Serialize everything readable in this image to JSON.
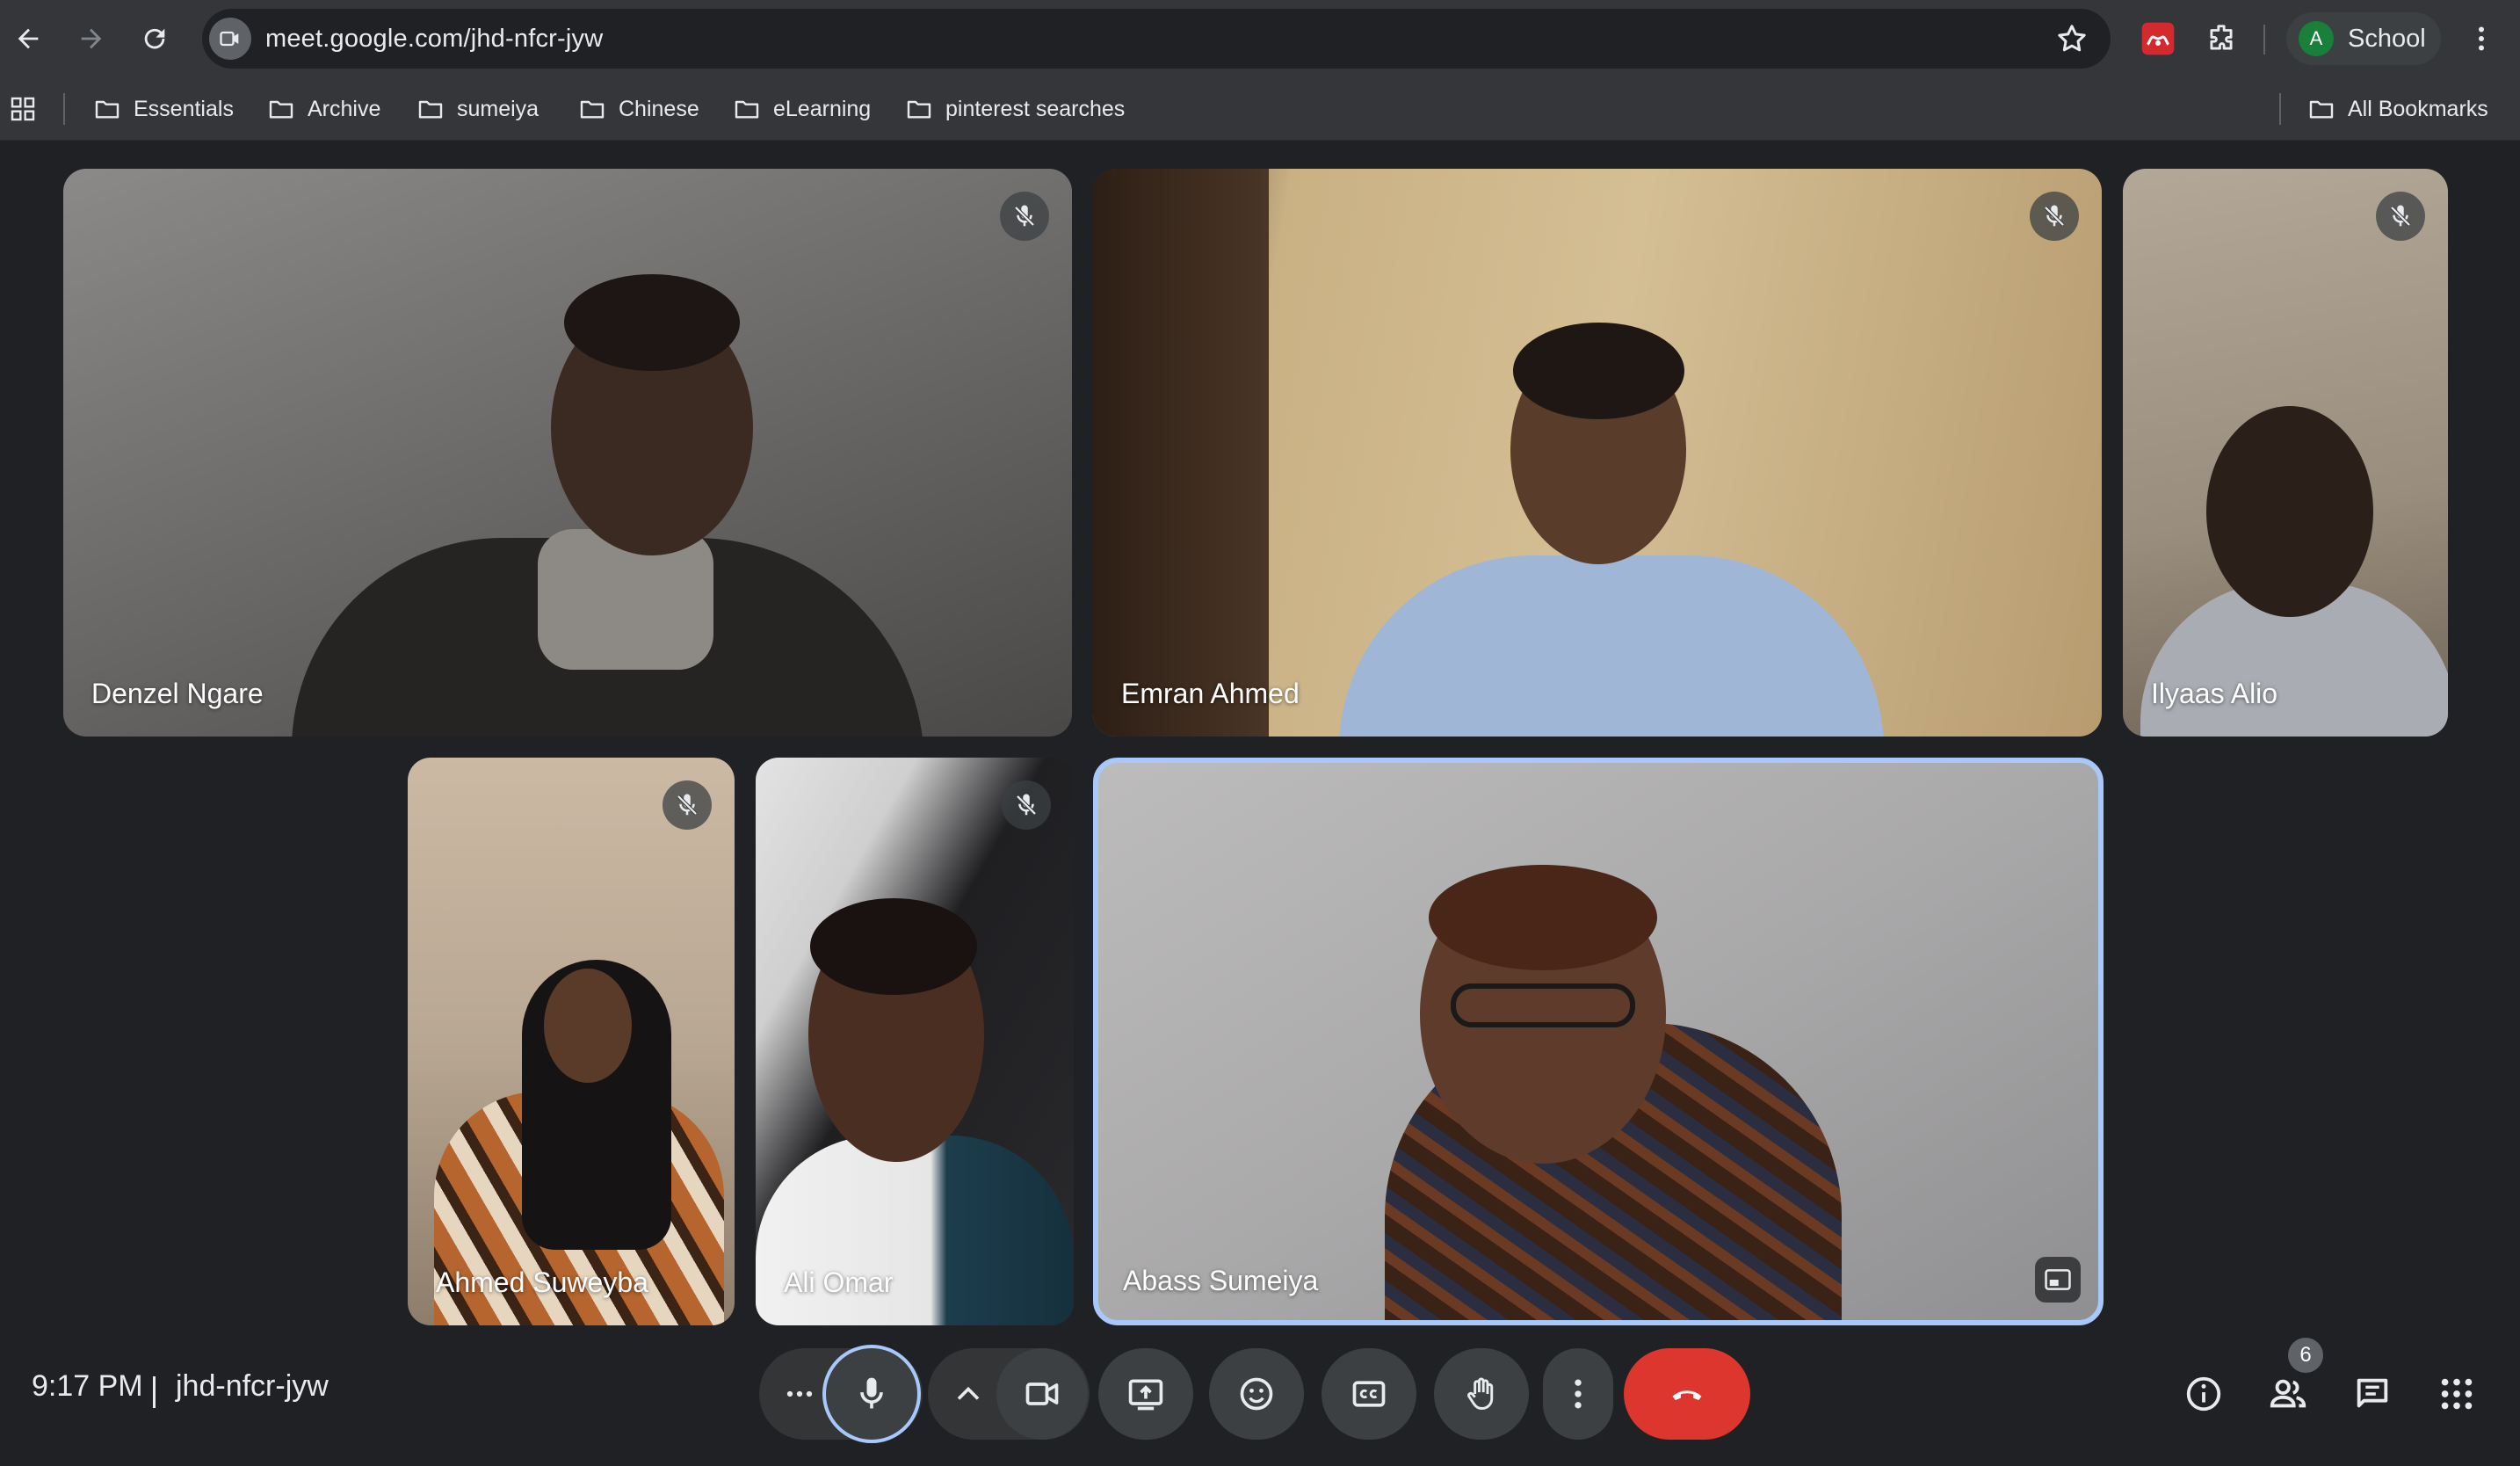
{
  "browser": {
    "url": "meet.google.com/jhd-nfcr-jyw",
    "profile": {
      "initial": "A",
      "label": "School"
    },
    "bookmarks": [
      "Essentials",
      "Archive",
      "sumeiya",
      "Chinese",
      "eLearning",
      "pinterest searches"
    ],
    "all_bookmarks": "All Bookmarks",
    "icons": [
      "back-icon",
      "forward-icon",
      "reload-icon",
      "site-info-icon",
      "star-icon",
      "mendeley-icon",
      "extensions-icon",
      "kebab-menu-icon",
      "apps-grid-icon",
      "folder-icon"
    ]
  },
  "meeting": {
    "participants": [
      {
        "name": "Denzel Ngare",
        "muted": true
      },
      {
        "name": "Emran Ahmed",
        "muted": true
      },
      {
        "name": "Ilyaas Alio",
        "muted": true
      },
      {
        "name": "Ahmed Suweyba",
        "muted": true
      },
      {
        "name": "Ali Omar",
        "muted": true
      },
      {
        "name": "Abass Sumeiya",
        "muted": false,
        "active_speaker": true
      }
    ],
    "time": "9:17 PM",
    "code": "jhd-nfcr-jyw",
    "people_count": "6",
    "controls": [
      "more-audio-options",
      "microphone",
      "video-options",
      "camera",
      "present-screen",
      "reactions",
      "captions",
      "raise-hand",
      "more-options",
      "leave-call"
    ],
    "side_controls": [
      "meeting-details",
      "people",
      "chat",
      "activities"
    ],
    "colors": {
      "accent_ring": "#a8c7fa",
      "leave_red": "#dc362e",
      "control_bg": "#3c4043"
    }
  }
}
